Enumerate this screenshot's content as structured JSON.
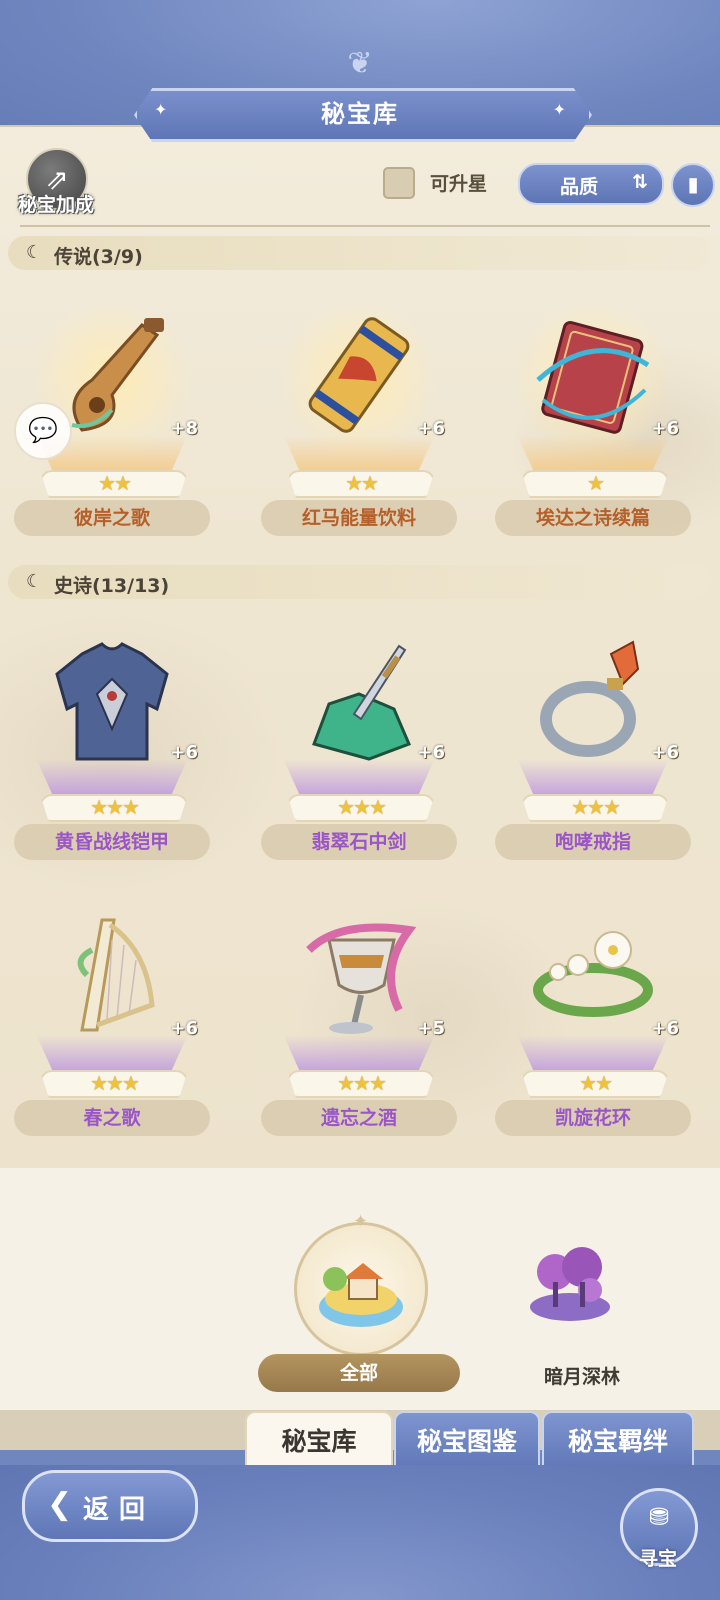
{
  "title": "秘宝库",
  "toolbar": {
    "bonus_label": "秘宝加成",
    "upgradable_label": "可升星",
    "sort_label": "品质",
    "sort_icon": "sort-arrows-icon",
    "info_icon": "book-icon"
  },
  "sections": [
    {
      "heading": "传说(3/9)",
      "items": [
        {
          "name": "彼岸之歌",
          "stars": "★★",
          "bonus": "+8"
        },
        {
          "name": "红马能量饮料",
          "stars": "★★",
          "bonus": "+6"
        },
        {
          "name": "埃达之诗续篇",
          "stars": "★",
          "bonus": "+6"
        }
      ]
    },
    {
      "heading": "史诗(13/13)",
      "items": [
        {
          "name": "黄昏战线铠甲",
          "stars": "★★★",
          "bonus": "+6"
        },
        {
          "name": "翡翠石中剑",
          "stars": "★★★",
          "bonus": "+6"
        },
        {
          "name": "咆哮戒指",
          "stars": "★★★",
          "bonus": "+6"
        },
        {
          "name": "春之歌",
          "stars": "★★★",
          "bonus": "+6"
        },
        {
          "name": "遗忘之酒",
          "stars": "★★★",
          "bonus": "+5"
        },
        {
          "name": "凯旋花环",
          "stars": "★★",
          "bonus": "+6"
        }
      ]
    }
  ],
  "regions": {
    "selected": "全部",
    "other": "暗月深林"
  },
  "tabs": [
    "秘宝库",
    "秘宝图鉴",
    "秘宝羁绊"
  ],
  "nav": {
    "back_label": "返回",
    "hunt_label": "寻宝"
  },
  "colors": {
    "accent_blue": "#6f86bf",
    "legend_orange": "#b5602b",
    "epic_purple": "#9a56c8",
    "star_gold": "#f0c23b"
  }
}
